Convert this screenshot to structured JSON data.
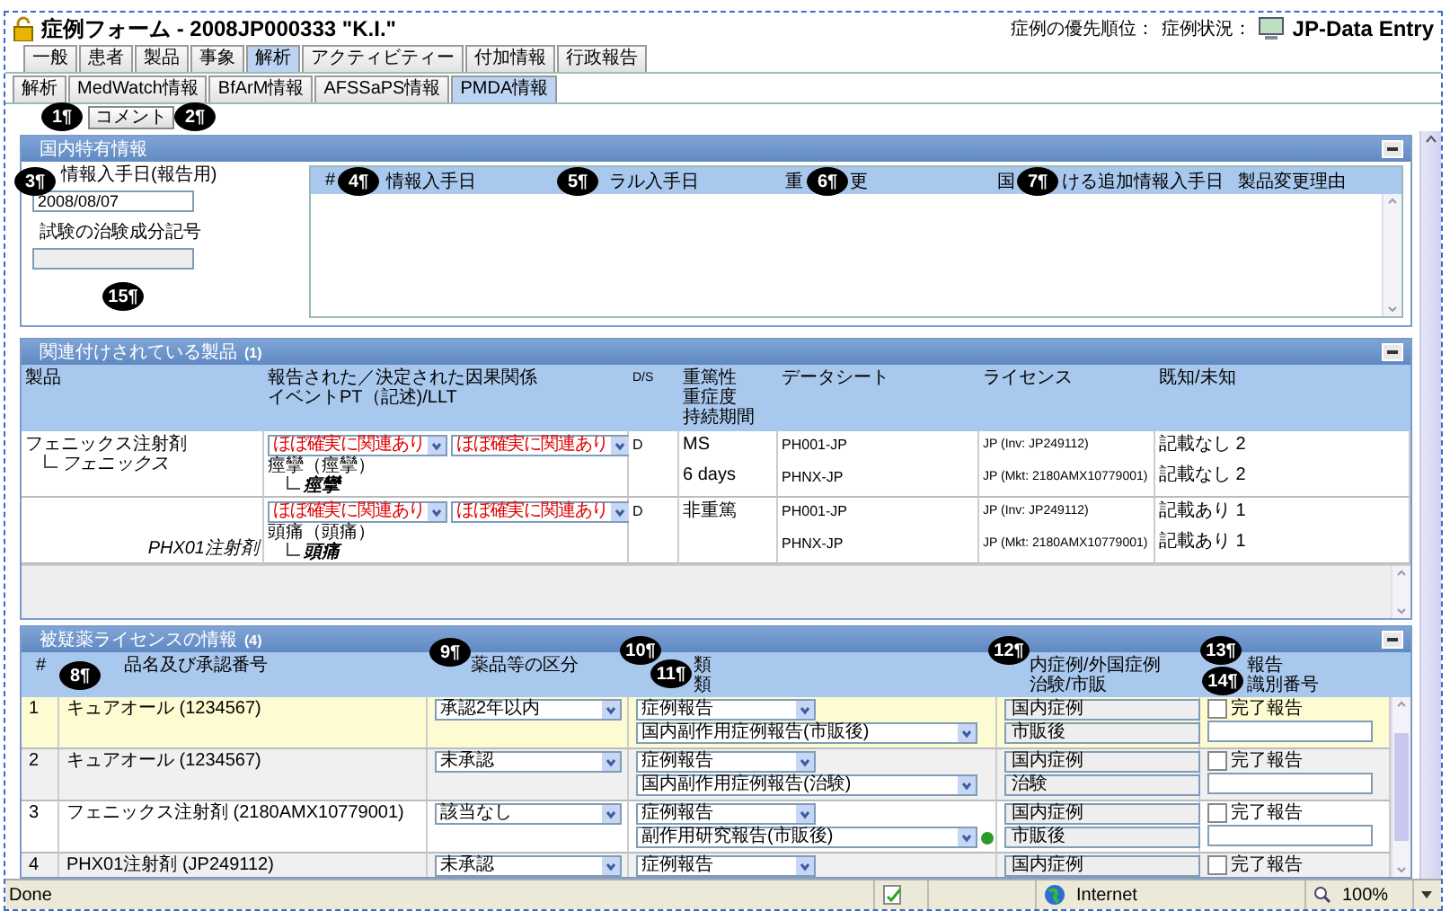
{
  "window": {
    "title": "症例フォーム - 2008JP000333 \"K.I.\"",
    "priority_label": "症例の優先順位：",
    "status_label": "症例状況：",
    "status": "JP-Data Entry"
  },
  "tabs": [
    {
      "label": "一般",
      "selected": false
    },
    {
      "label": "患者",
      "selected": false
    },
    {
      "label": "製品",
      "selected": false
    },
    {
      "label": "事象",
      "selected": false
    },
    {
      "label": "解析",
      "selected": true
    },
    {
      "label": "アクティビティー",
      "selected": false
    },
    {
      "label": "付加情報",
      "selected": false
    },
    {
      "label": "行政報告",
      "selected": false
    }
  ],
  "subtabs": [
    {
      "label": "解析",
      "selected": false
    },
    {
      "label": "MedWatch情報",
      "selected": false
    },
    {
      "label": "BfArM情報",
      "selected": false
    },
    {
      "label": "AFSSaPS情報",
      "selected": false
    },
    {
      "label": "PMDA情報",
      "selected": true
    }
  ],
  "toolbar": {
    "buttons": [
      "コメント"
    ]
  },
  "callouts": [
    "1¶",
    "2¶",
    "3¶",
    "4¶",
    "5¶",
    "6¶",
    "7¶",
    "15¶",
    "8¶",
    "9¶",
    "10¶",
    "11¶",
    "12¶",
    "13¶",
    "14¶"
  ],
  "domestic": {
    "title": "国内特有情報",
    "date_label": "情報入手日(報告用)",
    "date_value": "2008/08/07",
    "code_label": "試験の治験成分記号",
    "columns": [
      {
        "text": "#"
      },
      {
        "text": "情報入手日"
      },
      {
        "text": "ラル入手日"
      },
      {
        "lead": "重",
        "text": "更"
      },
      {
        "lead": "国",
        "text": "ける追加情報入手日"
      },
      {
        "text": "製品変更理由"
      }
    ]
  },
  "products": {
    "title": "関連付けされている製品",
    "count": "(1)",
    "columns": [
      [
        "製品"
      ],
      [
        "報告された／決定された因果関係",
        "イベントPT（記述)/LLT"
      ],
      [
        "D/S"
      ],
      [
        "重篤性",
        "重症度",
        "持続期間"
      ],
      [
        "データシート"
      ],
      [
        "ライセンス"
      ],
      [
        "既知/未知"
      ]
    ],
    "name": "フェニックス注射剤",
    "child": "フェニックス",
    "events": [
      {
        "causality": [
          "ほぼ確実に関連あり",
          "ほぼ確実に関連あり"
        ],
        "pt": "痙攣（痙攣）",
        "llt": "痙攣",
        "ds": "D",
        "seriousness": [
          "MS",
          "6 days"
        ],
        "datasheets": [
          "PH001-JP",
          "PHNX-JP"
        ],
        "licenses": [
          "JP (Inv: JP249112)",
          "JP (Mkt: 2180AMX10779001)"
        ],
        "known": [
          "記載なし 2",
          "記載なし 2"
        ]
      },
      {
        "causality": [
          "ほぼ確実に関連あり",
          "ほぼ確実に関連あり"
        ],
        "pt": "頭痛（頭痛）",
        "llt": "頭痛",
        "linked_product": "PHX01注射剤",
        "ds": "D",
        "seriousness": [
          "非重篤"
        ],
        "datasheets": [
          "PH001-JP",
          "PHNX-JP"
        ],
        "licenses": [
          "JP (Inv: JP249112)",
          "JP (Mkt: 2180AMX10779001)"
        ],
        "known": [
          "記載あり 1",
          "記載あり 1"
        ]
      }
    ]
  },
  "licenses": {
    "title": "被疑薬ライセンスの情報",
    "count": "(4)",
    "columns": [
      [
        "#"
      ],
      [
        "品名及び承認番号"
      ],
      [
        "薬品等の区分"
      ],
      [
        "類",
        "類"
      ],
      [
        "内症例/外国症例",
        "治験/市販"
      ],
      [
        "報告",
        "識別番号"
      ]
    ],
    "rows": [
      {
        "num": "1",
        "name": "キュアオール (1234567)",
        "class": "承認2年以内",
        "report_type": "症例報告",
        "report_category": "国内副作用症例報告(市販後)",
        "origin": "国内症例",
        "phase": "市販後",
        "completed_label": "完了報告",
        "completed": false,
        "flag": false,
        "selected": true
      },
      {
        "num": "2",
        "name": "キュアオール (1234567)",
        "class": "未承認",
        "report_type": "症例報告",
        "report_category": "国内副作用症例報告(治験)",
        "origin": "国内症例",
        "phase": "治験",
        "completed_label": "完了報告",
        "completed": false,
        "flag": false,
        "selected": false
      },
      {
        "num": "3",
        "name": "フェニックス注射剤 (2180AMX10779001)",
        "class": "該当なし",
        "report_type": "症例報告",
        "report_category": "副作用研究報告(市販後)",
        "origin": "国内症例",
        "phase": "市販後",
        "completed_label": "完了報告",
        "completed": false,
        "flag": true,
        "selected": false
      },
      {
        "num": "4",
        "name": "PHX01注射剤 (JP249112)",
        "class": "未承認",
        "report_type": "症例報告",
        "origin": "国内症例",
        "completed_label": "完了報告",
        "completed": false,
        "flag": false,
        "selected": false
      }
    ]
  },
  "status_bar": {
    "text": "Done",
    "zone": "Internet",
    "zoom": "100%"
  }
}
